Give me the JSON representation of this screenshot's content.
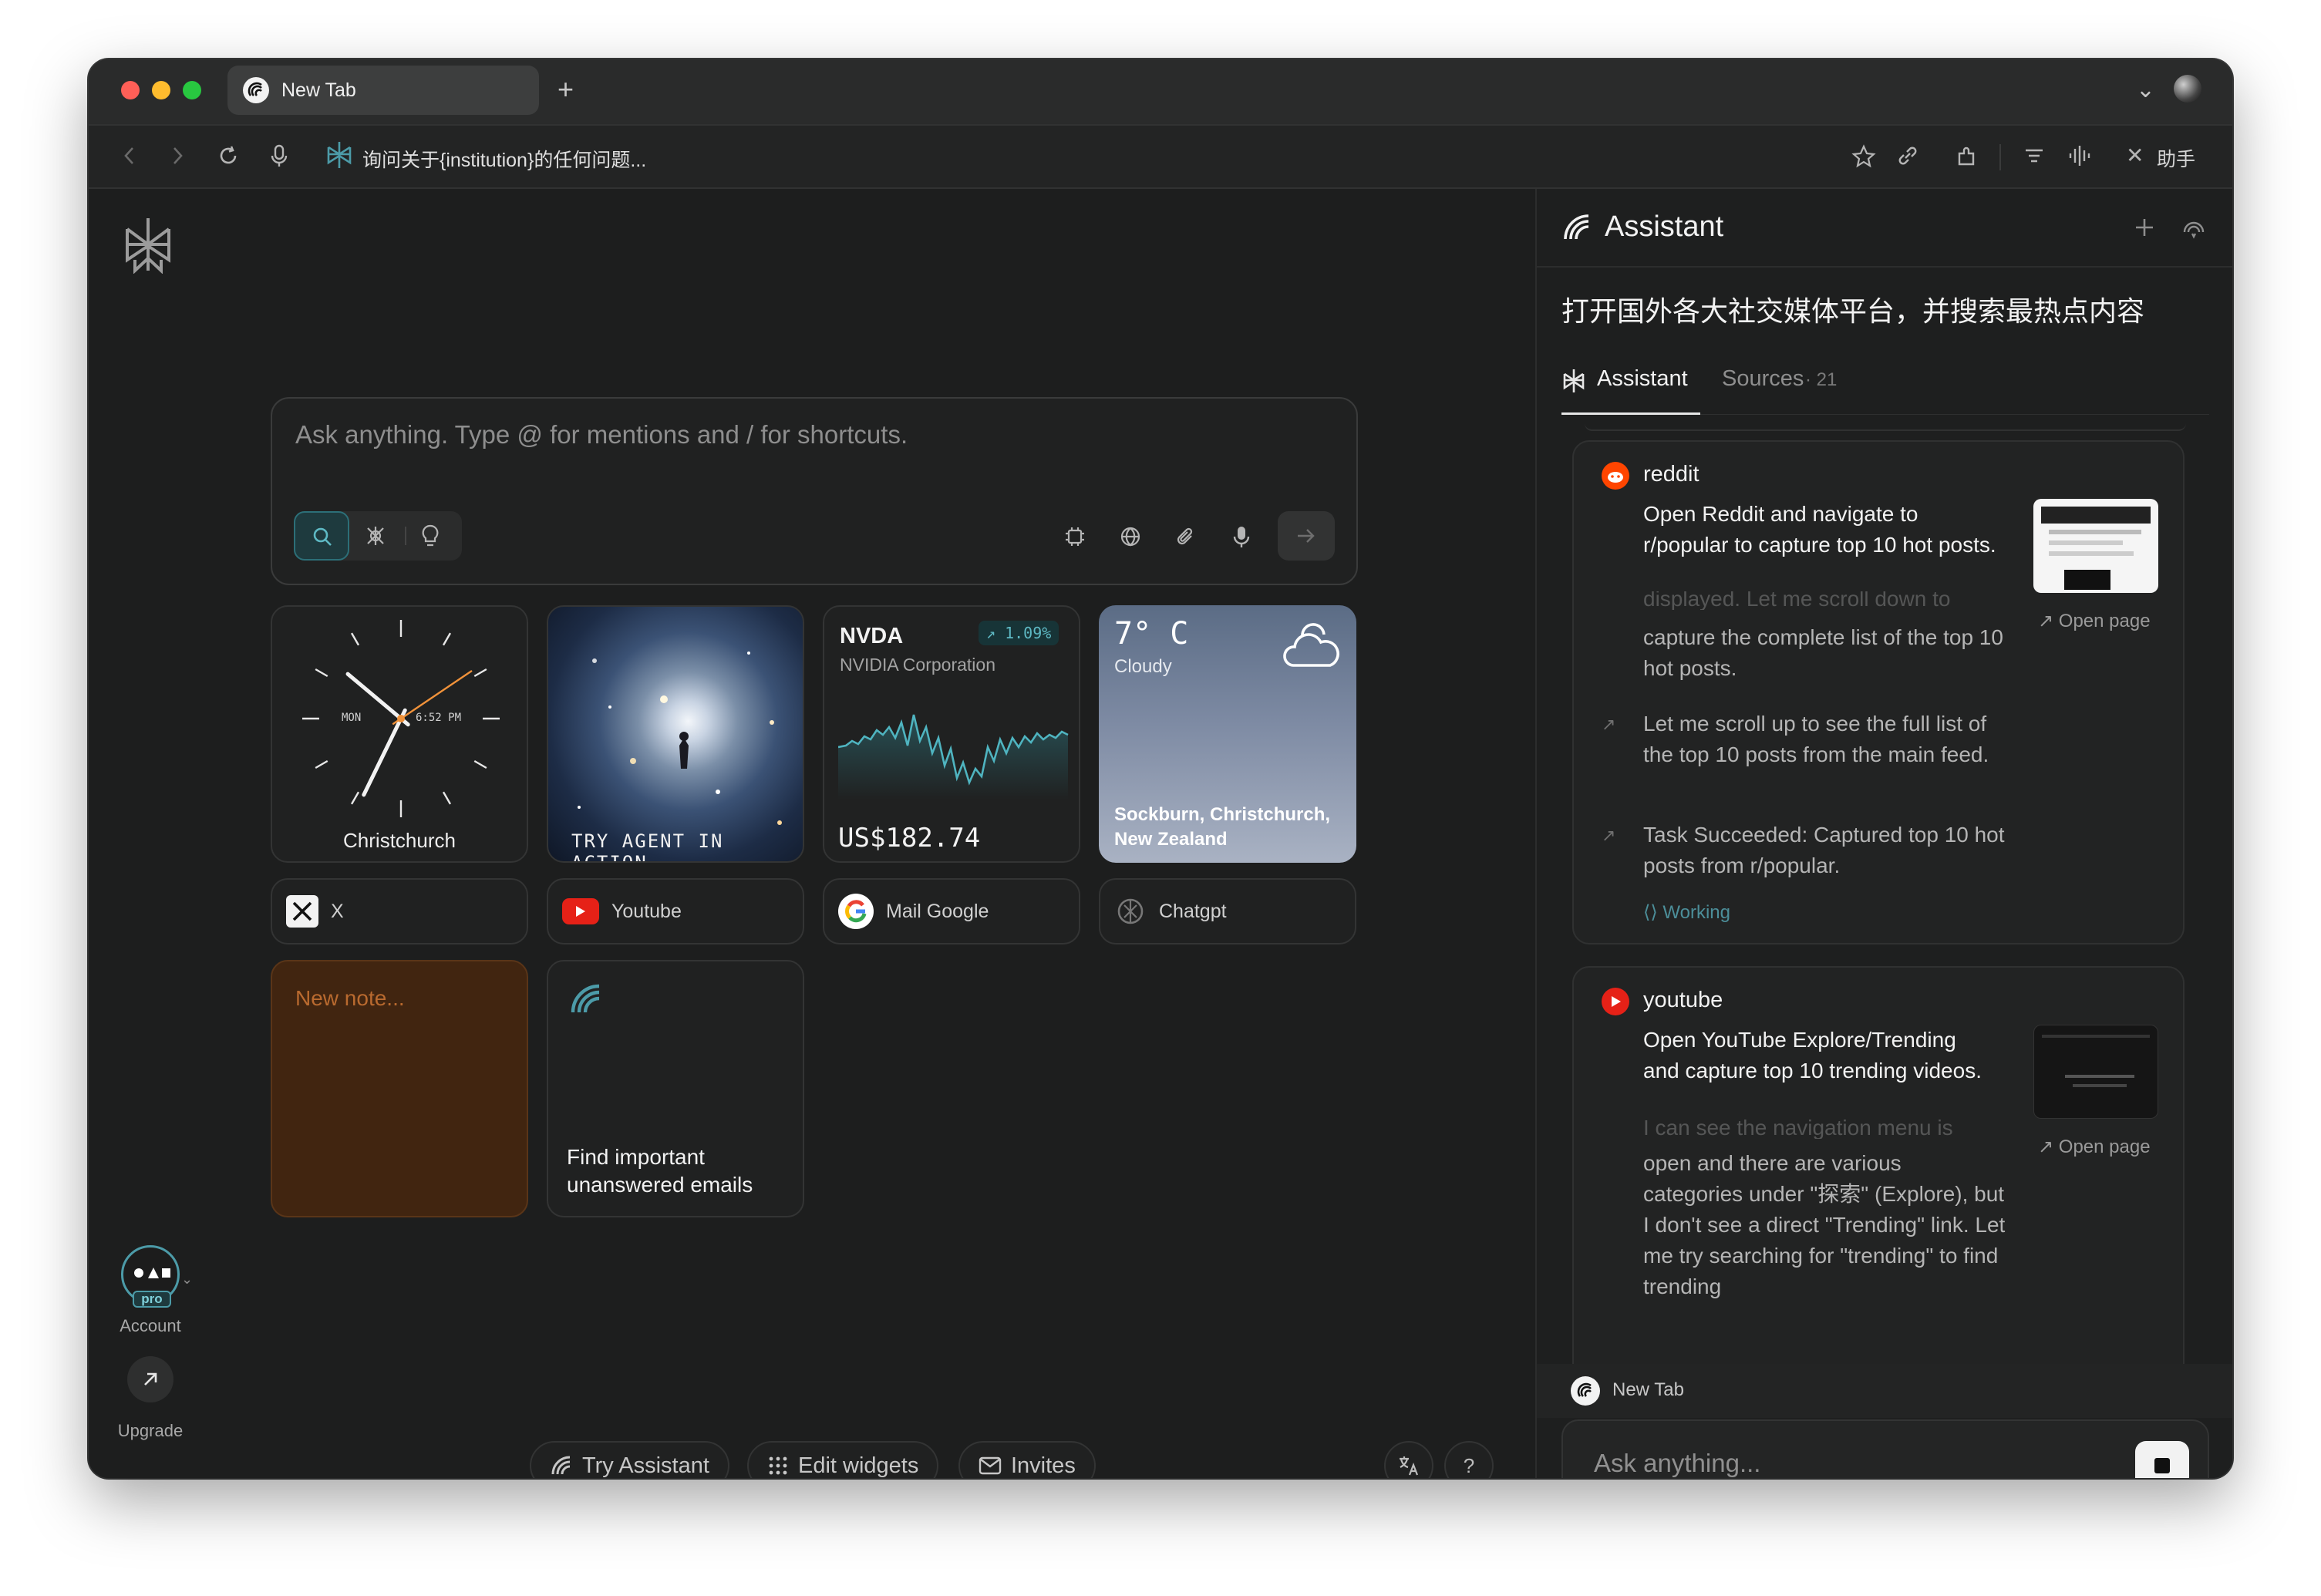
{
  "tabbar": {
    "tab_title": "New Tab",
    "new_tab": "+",
    "menu_chevron": "⌄"
  },
  "addressbar": {
    "url_text": "询问关于{institution}的任何问题...",
    "assistant_label": "助手",
    "close_glyph": "✕"
  },
  "search": {
    "placeholder": "Ask anything. Type @ for mentions and / for shortcuts."
  },
  "widgets": {
    "clock": {
      "city": "Christchurch",
      "day": "MON",
      "time": "6:52 PM"
    },
    "agent": {
      "label": "TRY AGENT IN ACTION"
    },
    "stock": {
      "ticker": "NVDA",
      "company": "NVIDIA Corporation",
      "change": "↗ 1.09%",
      "price": "US$182.74"
    },
    "weather": {
      "temp": "7° C",
      "condition": "Cloudy",
      "location": "Sockburn, Christchurch, New Zealand"
    }
  },
  "links": [
    {
      "label": "X"
    },
    {
      "label": "Youtube"
    },
    {
      "label": "Mail Google"
    },
    {
      "label": "Chatgpt"
    }
  ],
  "note": {
    "placeholder": "New note..."
  },
  "email_card": {
    "text": "Find important unanswered emails"
  },
  "sidebar": {
    "account": "Account",
    "upgrade": "Upgrade",
    "pro_badge": "pro"
  },
  "bottom": {
    "try_assistant": "Try Assistant",
    "edit_widgets": "Edit widgets",
    "invites": "Invites",
    "help": "?"
  },
  "assistant": {
    "title": "Assistant",
    "question": "打开国外各大社交媒体平台，并搜索最热点内容",
    "tabs": {
      "assistant": "Assistant",
      "sources": "Sources",
      "sources_count": "· 21"
    },
    "steps": [
      {
        "source": "reddit",
        "headline": "Open Reddit and navigate to r/popular to capture top 10 hot posts.",
        "faded": "displayed. Let me scroll down to",
        "text": "capture the complete list of the top 10 hot posts.",
        "sub": [
          "Let me scroll up to see the full list of the top 10 posts from the main feed.",
          "Task Succeeded: Captured top 10 hot posts from r/popular."
        ],
        "status": "Working",
        "open_page": "Open page"
      },
      {
        "source": "youtube",
        "headline": "Open YouTube Explore/Trending and capture top 10 trending videos.",
        "faded": "I can see the navigation menu is",
        "text": "open and there are various categories under \"探索\" (Explore), but I don't see a direct \"Trending\" link. Let me try searching for \"trending\" to find trending",
        "open_page": "Open page"
      }
    ],
    "context_tab": "New Tab",
    "input_placeholder": "Ask anything..."
  },
  "colors": {
    "accent": "#4c9ba8",
    "background": "#1d1e1e",
    "note": "#412510"
  }
}
